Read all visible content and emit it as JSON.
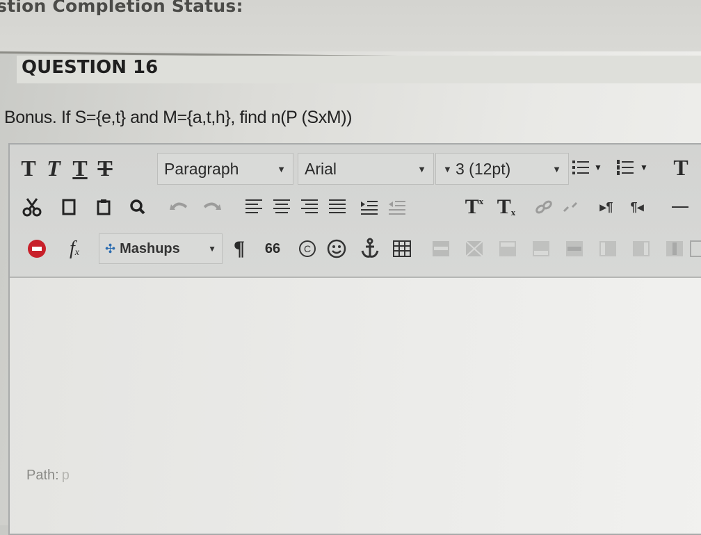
{
  "page": {
    "status_heading": "estion Completion Status:",
    "question_title": "QUESTION 16",
    "question_text": "Bonus. If S={e,t} and M={a,t,h}, find n(P (SxM))"
  },
  "toolbar": {
    "format_buttons": [
      "T",
      "T",
      "T",
      "T"
    ],
    "paragraph_select": "Paragraph",
    "font_select": "Arial",
    "size_select": "3 (12pt)",
    "superscript_label": "T",
    "subscript_label": "T",
    "function_label": "f",
    "mashups_label": "Mashups",
    "pilcrow": "¶",
    "quote": "66"
  },
  "editor": {
    "path_label": "Path:",
    "path_value": "p"
  },
  "colors": {
    "toolbar_bg": "#d4d5d3",
    "stop_icon": "#c8202a",
    "accent_blue": "#2b6cb0"
  }
}
